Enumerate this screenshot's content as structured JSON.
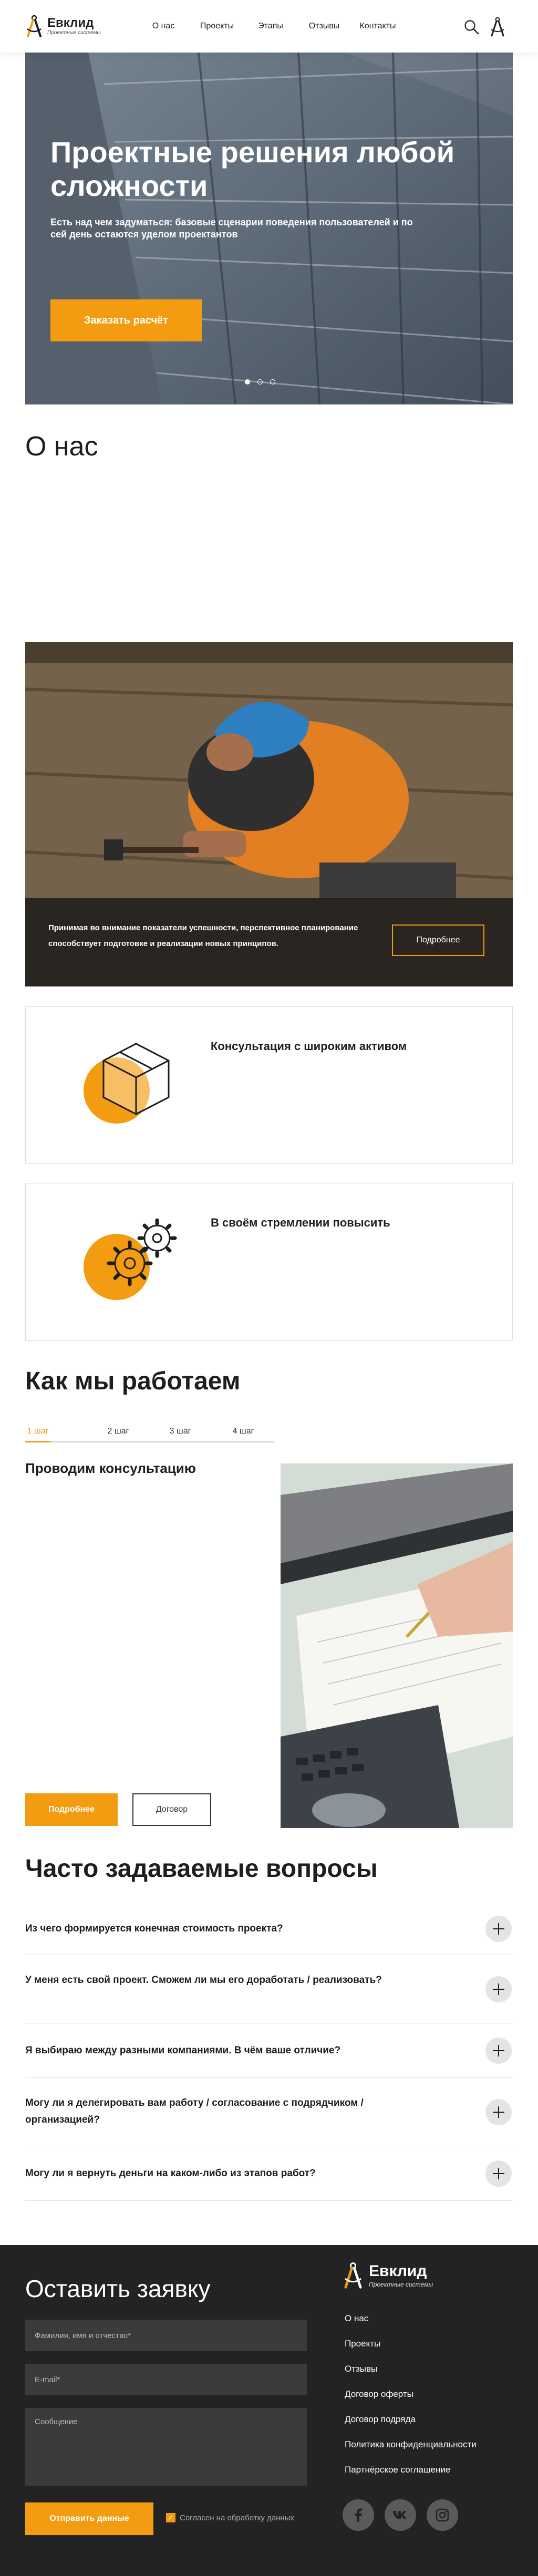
{
  "brand": {
    "name": "Евклид",
    "tagline": "Проектные системы",
    "accent": "#f39c12"
  },
  "nav": {
    "items": [
      "О нас",
      "Проекты",
      "Этапы",
      "Отзывы",
      "Контакты"
    ]
  },
  "hero": {
    "title": "Проектные решения любой сложности",
    "subtitle": "Есть над чем задуматься: базовые сценарии поведения пользователей и по сей день остаются уделом проектантов",
    "button": "Заказать расчёт",
    "slide_count": 3,
    "active_slide": 1
  },
  "about": {
    "title": "О нас",
    "text": ""
  },
  "worker_banner": {
    "text": "Принимая во внимание показатели успешности, перспективное планирование способствует подготовке и реализации новых принципов.",
    "button": "Подробнее"
  },
  "cards": [
    {
      "title": "Консультация с широким активом",
      "text": ""
    },
    {
      "title": "В своём стремлении повысить",
      "text": ""
    }
  ],
  "how": {
    "title": "Как мы работаем",
    "tabs": [
      "1 шаг",
      "2 шаг",
      "3 шаг",
      "4 шаг"
    ],
    "active_tab": 0,
    "step_title": "Проводим консультацию",
    "step_text": "",
    "primary_button": "Подробнее",
    "secondary_button": "Договор"
  },
  "faq": {
    "title": "Часто задаваемые вопросы",
    "items": [
      "Из чего формируется конечная стоимость проекта?",
      "У меня есть свой проект. Сможем ли мы его доработать / реализовать?",
      "Я выбираю между разными компаниями. В чём ваше отличие?",
      "Могу ли я делегировать вам работу / согласование с подрядчиком / организацией?",
      "Могу ли я вернуть деньги на каком-либо из этапов работ?"
    ]
  },
  "form": {
    "title": "Оставить заявку",
    "name_placeholder": "Фамилия, имя и отчество*",
    "email_placeholder": "E-mail*",
    "message_placeholder": "Сообщение",
    "submit": "Отправить данные",
    "consent": "Согласен на обработку данных",
    "consent_checked": true
  },
  "footer": {
    "links": [
      "О нас",
      "Проекты",
      "Отзывы",
      "Договор оферты",
      "Договор подряда",
      "Политика конфиденциальности",
      "Партнёрское соглашение"
    ],
    "socials": [
      "facebook-icon",
      "vk-icon",
      "instagram-icon"
    ]
  }
}
